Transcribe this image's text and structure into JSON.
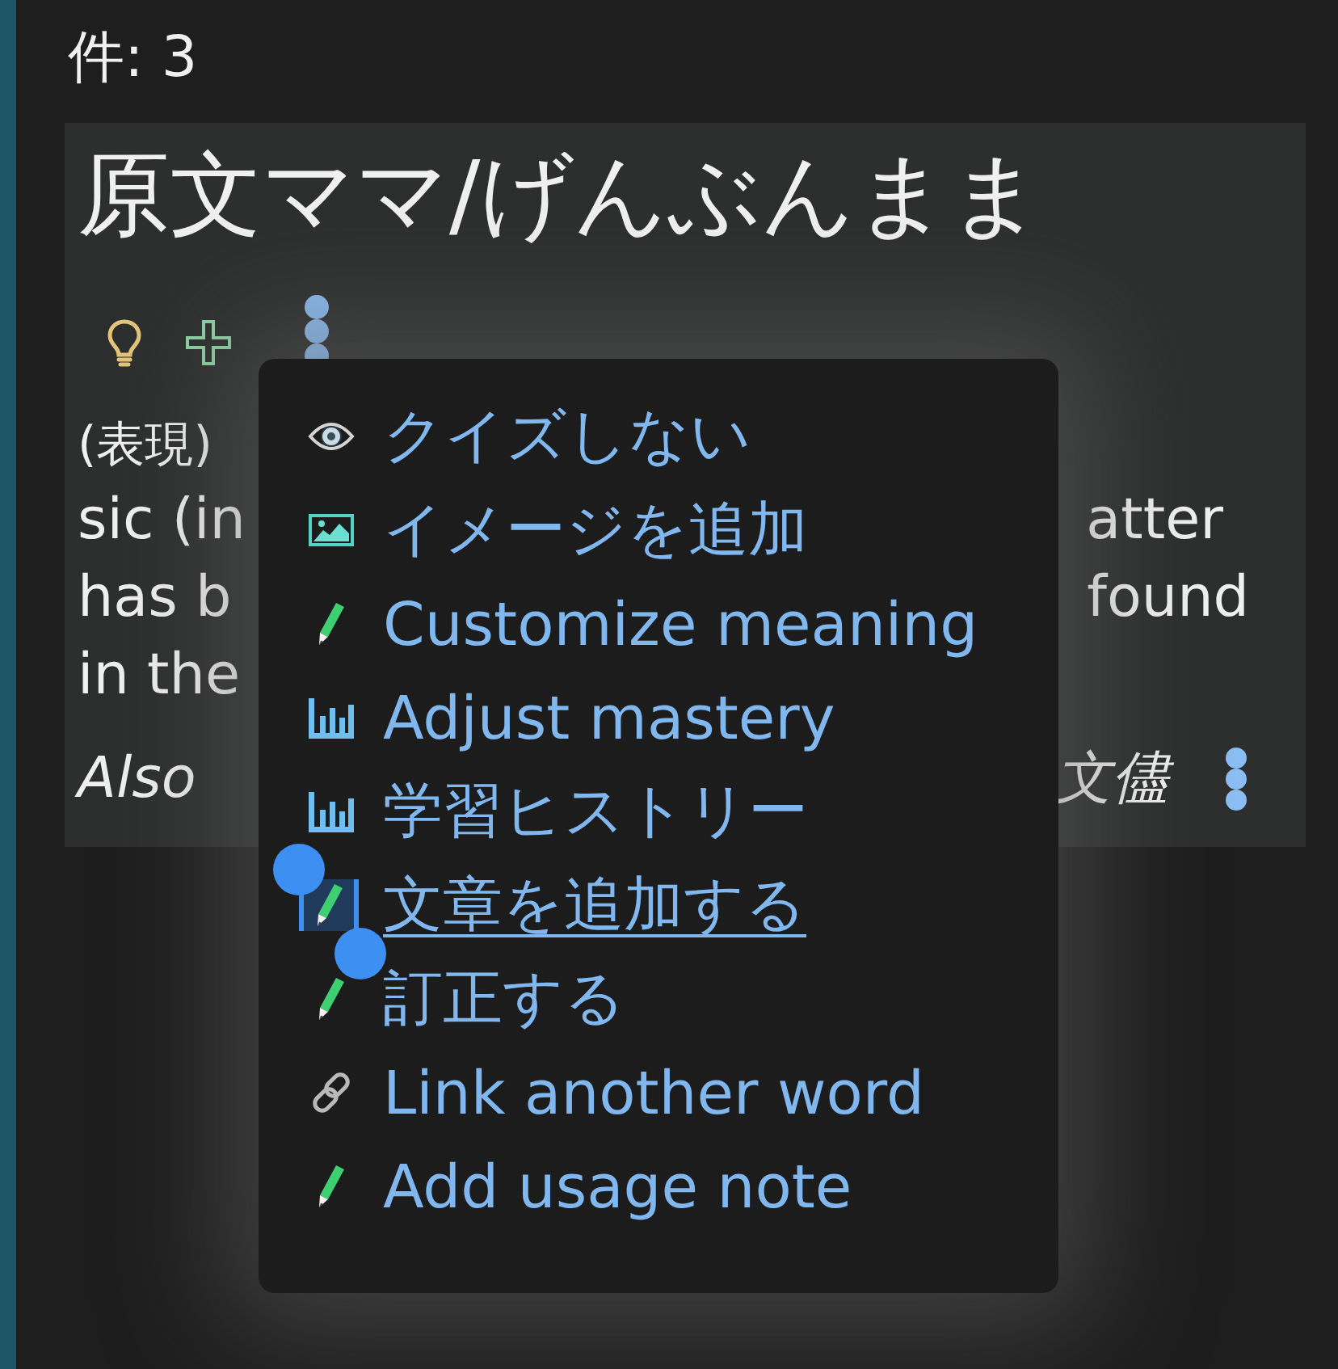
{
  "count_label": "件: 3",
  "entry": {
    "title": "原文ママ/げんぶんまま",
    "part_of_speech": "(表現)",
    "definition_lines": [
      {
        "left": "sic (in",
        "right": "atter"
      },
      {
        "left": "has b",
        "right": "found"
      },
      {
        "left": "in the"
      }
    ],
    "also_written": {
      "left": "Also",
      "right": "文儘"
    }
  },
  "menu": {
    "items": [
      {
        "kind": "hide",
        "label": "クイズしない",
        "selected": false
      },
      {
        "kind": "image",
        "label": "イメージを追加",
        "selected": false
      },
      {
        "kind": "edit",
        "label": "Customize meaning",
        "selected": false
      },
      {
        "kind": "stats",
        "label": "Adjust mastery",
        "selected": false
      },
      {
        "kind": "stats",
        "label": "学習ヒストリー",
        "selected": false
      },
      {
        "kind": "edit",
        "label": "文章を追加する",
        "selected": true
      },
      {
        "kind": "edit",
        "label": "訂正する",
        "selected": false
      },
      {
        "kind": "link",
        "label": "Link another word",
        "selected": false
      },
      {
        "kind": "edit",
        "label": "Add usage note",
        "selected": false
      }
    ]
  }
}
